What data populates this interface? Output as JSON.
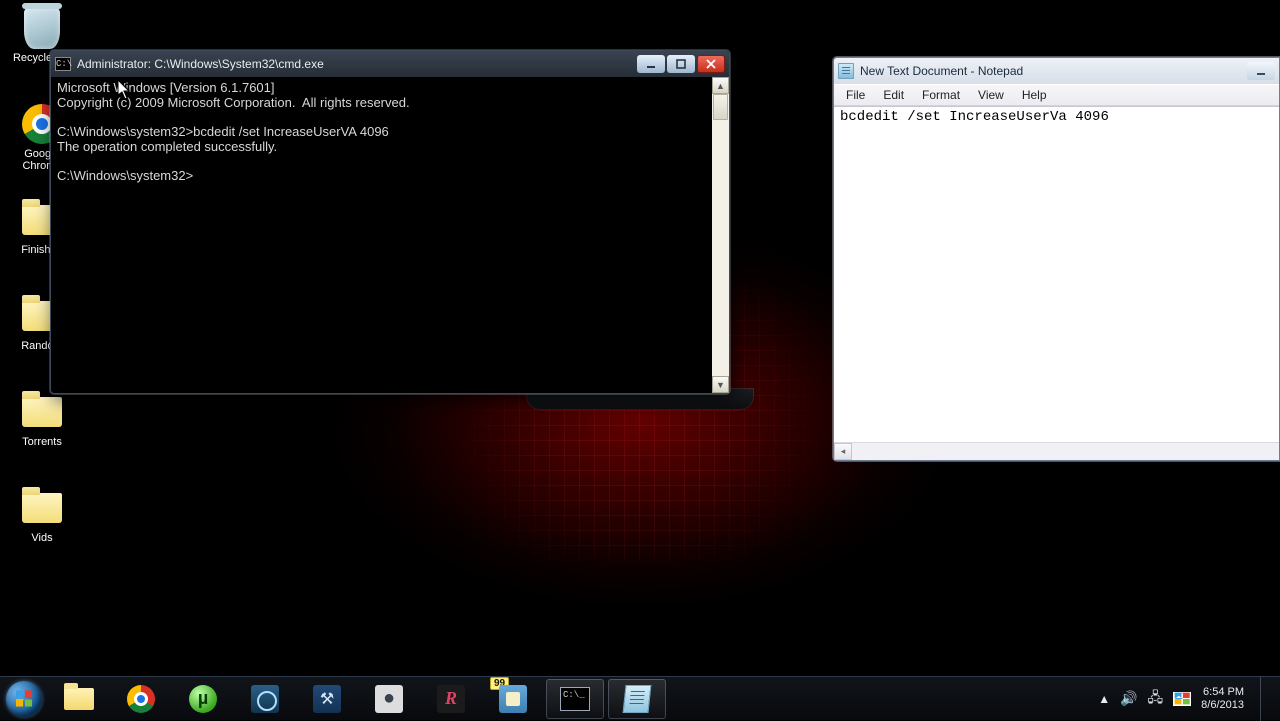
{
  "desktop_icons": [
    {
      "label": "Recycle Bin",
      "type": "bin"
    },
    {
      "label": "Google Chrome",
      "type": "chrome"
    },
    {
      "label": "Finished",
      "type": "folder"
    },
    {
      "label": "Random",
      "type": "folder"
    },
    {
      "label": "Torrents",
      "type": "folder"
    },
    {
      "label": "Vids",
      "type": "folder"
    }
  ],
  "cmd": {
    "title": "Administrator: C:\\Windows\\System32\\cmd.exe",
    "line1": "Microsoft Windows [Version 6.1.7601]",
    "line2": "Copyright (c) 2009 Microsoft Corporation.  All rights reserved.",
    "line3": "C:\\Windows\\system32>bcdedit /set IncreaseUserVA 4096",
    "line4": "The operation completed successfully.",
    "line5": "C:\\Windows\\system32>"
  },
  "notepad": {
    "title": "New Text Document - Notepad",
    "menu": [
      "File",
      "Edit",
      "Format",
      "View",
      "Help"
    ],
    "content": "bcdedit /set IncreaseUserVa 4096"
  },
  "taskbar": {
    "badge": "99"
  },
  "tray": {
    "time": "6:54 PM",
    "date": "8/6/2013"
  }
}
